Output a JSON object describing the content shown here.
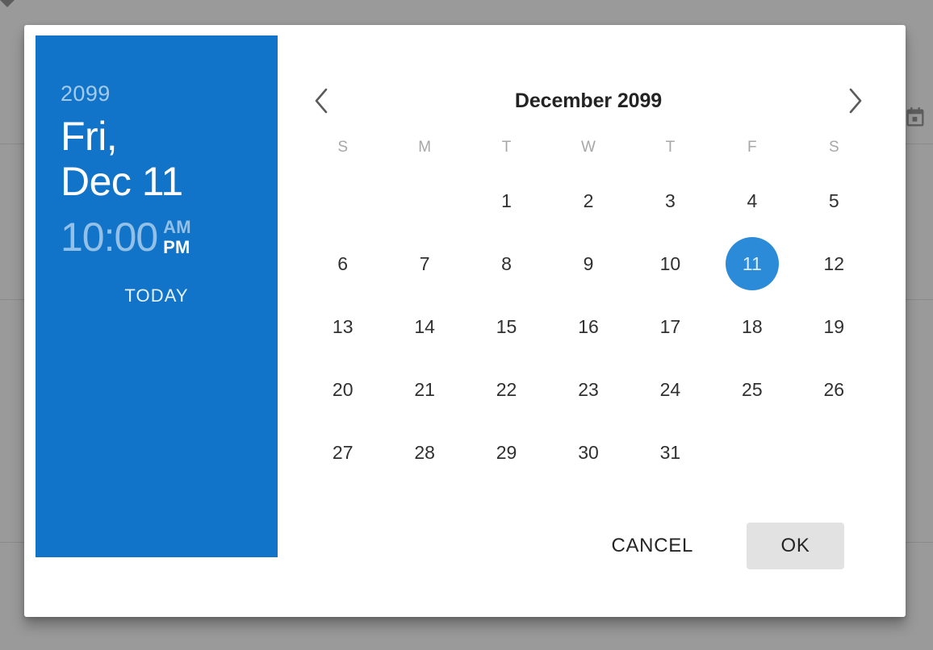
{
  "background": {
    "calendar_icon": "calendar-icon",
    "dropdown_icon": "caret-down-icon"
  },
  "summary": {
    "year": "2099",
    "weekday": "Fri,",
    "month_day": "Dec 11",
    "clock": "10:00",
    "am_label": "AM",
    "pm_label": "PM",
    "meridiem_selected": "PM",
    "today_label": "TODAY",
    "panel_color": "#1174c9"
  },
  "calendar": {
    "prev_icon": "chevron-left-icon",
    "next_icon": "chevron-right-icon",
    "title": "December 2099",
    "weekdays": [
      "S",
      "M",
      "T",
      "W",
      "T",
      "F",
      "S"
    ],
    "leading_blanks": 2,
    "days": [
      1,
      2,
      3,
      4,
      5,
      6,
      7,
      8,
      9,
      10,
      11,
      12,
      13,
      14,
      15,
      16,
      17,
      18,
      19,
      20,
      21,
      22,
      23,
      24,
      25,
      26,
      27,
      28,
      29,
      30,
      31
    ],
    "selected_day": 11,
    "selected_color": "#2b8bd8"
  },
  "actions": {
    "cancel_label": "CANCEL",
    "ok_label": "OK"
  }
}
